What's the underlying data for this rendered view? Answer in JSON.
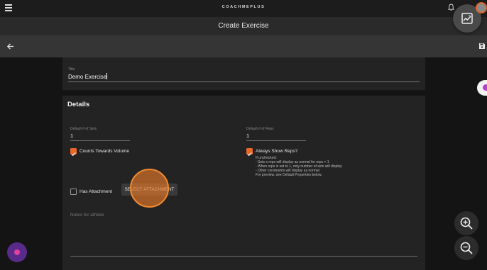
{
  "header": {
    "brand": "COACHMEPLUS"
  },
  "titlebar": {
    "title": "Create Exercise"
  },
  "exercise": {
    "title_label": "Title",
    "title_value": "Demo Exercise"
  },
  "details": {
    "heading": "Details",
    "sets": {
      "label": "Default # of Sets",
      "value": "1"
    },
    "reps": {
      "label": "Default # of Reps",
      "value": "1"
    },
    "counts_towards_volume": {
      "label": "Counts Towards Volume",
      "checked": true
    },
    "always_show_reps": {
      "label": "Always Show Reps?",
      "checked": true,
      "help": [
        "If unchecked:",
        "- Sets x reps will display as normal for reps > 1",
        "- When reps is set to 1, only number of sets will display",
        "- Other constraints will display as normal",
        "For preview, see Default Properties below."
      ]
    },
    "has_attachment": {
      "label": "Has Attachment",
      "checked": false
    },
    "select_attachment_label": "SELECT ATTACHMENT",
    "notes_placeholder": "Notes for athlete"
  },
  "colors": {
    "accent": "#e8682a",
    "background": "#141414",
    "card": "#232323"
  },
  "icons": [
    "menu-icon",
    "bell-icon",
    "image-icon",
    "back-arrow-icon",
    "save-icon",
    "zoom-in-icon",
    "zoom-out-icon"
  ]
}
